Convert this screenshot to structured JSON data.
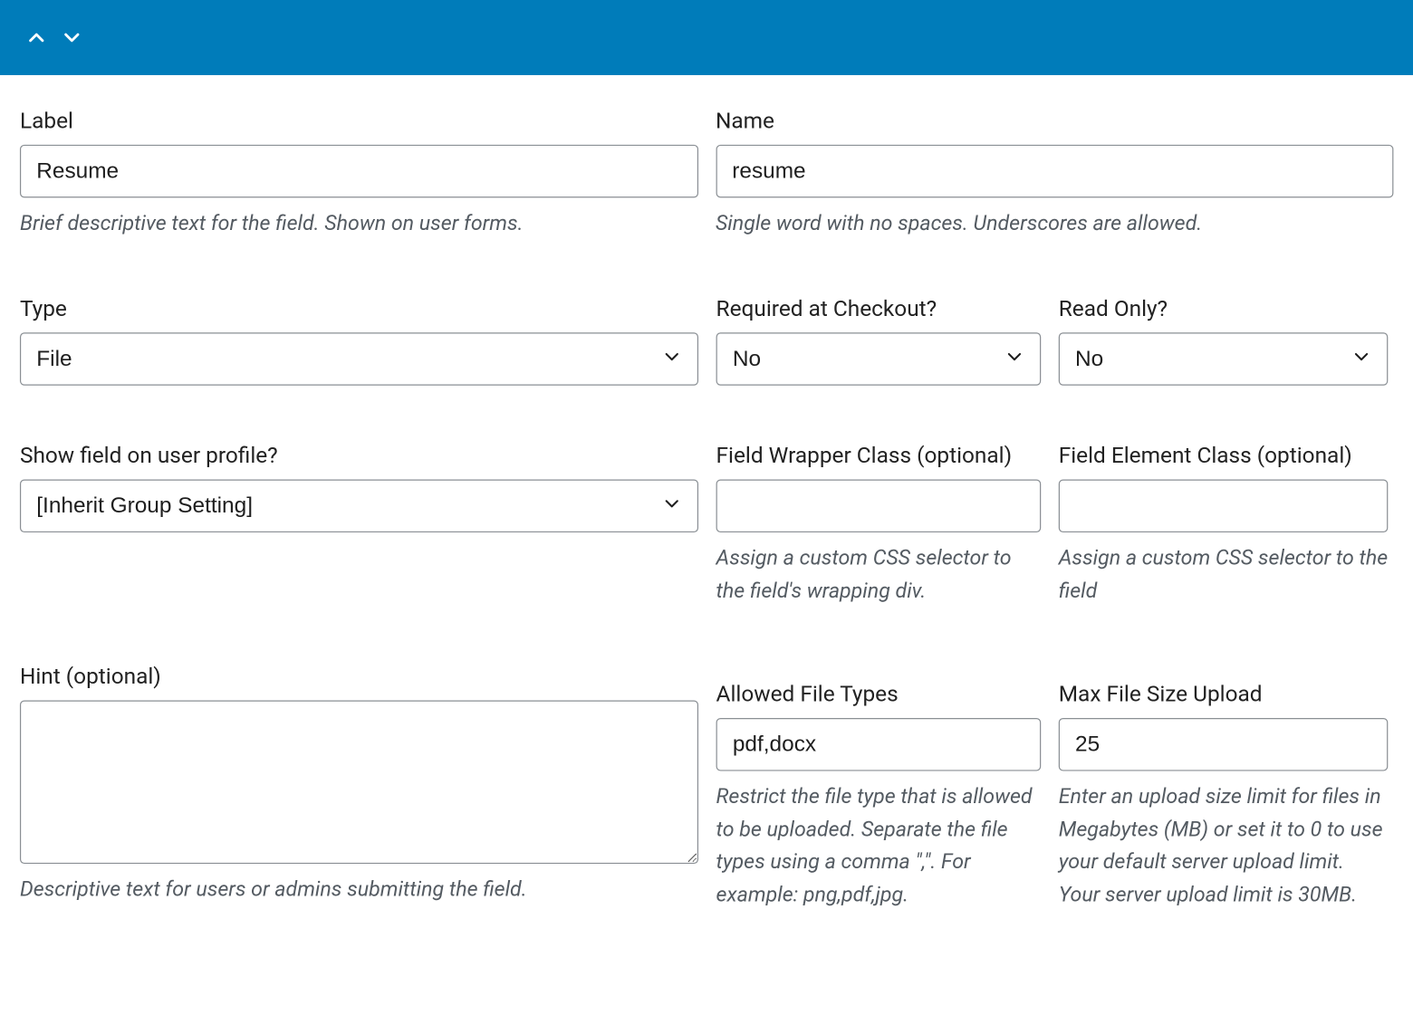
{
  "header": {},
  "fields": {
    "label": {
      "title": "Label",
      "value": "Resume",
      "help": "Brief descriptive text for the field. Shown on user forms."
    },
    "name": {
      "title": "Name",
      "value": "resume",
      "help": "Single word with no spaces. Underscores are allowed."
    },
    "type": {
      "title": "Type",
      "value": "File"
    },
    "required": {
      "title": "Required at Checkout?",
      "value": "No"
    },
    "readonly": {
      "title": "Read Only?",
      "value": "No"
    },
    "show_profile": {
      "title": "Show field on user profile?",
      "value": "[Inherit Group Setting]"
    },
    "wrapper_class": {
      "title": "Field Wrapper Class (optional)",
      "value": "",
      "help": "Assign a custom CSS selector to the field's wrapping div."
    },
    "element_class": {
      "title": "Field Element Class (optional)",
      "value": "",
      "help": "Assign a custom CSS selector to the field"
    },
    "hint": {
      "title": "Hint (optional)",
      "value": "",
      "help": "Descriptive text for users or admins submitting the field."
    },
    "allowed_types": {
      "title": "Allowed File Types",
      "value": "pdf,docx",
      "help": "Restrict the file type that is allowed to be uploaded. Separate the file types using a comma \",\". For example: png,pdf,jpg."
    },
    "max_size": {
      "title": "Max File Size Upload",
      "value": "25",
      "help": "Enter an upload size limit for files in Megabytes (MB) or set it to 0 to use your default server upload limit. Your server upload limit is 30MB."
    }
  }
}
